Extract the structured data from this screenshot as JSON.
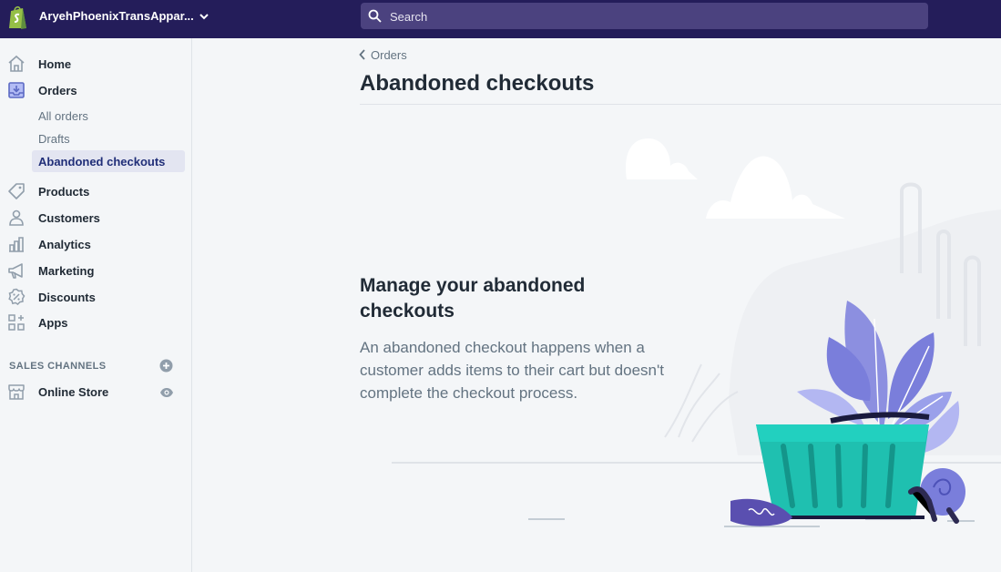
{
  "topbar": {
    "store_name": "AryehPhoenixTransAppar...",
    "search_placeholder": "Search"
  },
  "sidebar": {
    "items": [
      {
        "label": "Home",
        "icon": "home-icon"
      },
      {
        "label": "Orders",
        "icon": "orders-icon"
      },
      {
        "label": "Products",
        "icon": "tag-icon"
      },
      {
        "label": "Customers",
        "icon": "person-icon"
      },
      {
        "label": "Analytics",
        "icon": "bar-chart-icon"
      },
      {
        "label": "Marketing",
        "icon": "megaphone-icon"
      },
      {
        "label": "Discounts",
        "icon": "discount-icon"
      },
      {
        "label": "Apps",
        "icon": "apps-icon"
      }
    ],
    "order_subitems": [
      {
        "label": "All orders",
        "active": false
      },
      {
        "label": "Drafts",
        "active": false
      },
      {
        "label": "Abandoned checkouts",
        "active": true
      }
    ],
    "sales_channels_heading": "SALES CHANNELS",
    "channels": [
      {
        "label": "Online Store",
        "icon": "store-icon"
      }
    ]
  },
  "main": {
    "breadcrumb": "Orders",
    "title": "Abandoned checkouts",
    "empty_state": {
      "heading": "Manage your abandoned checkouts",
      "body": "An abandoned checkout happens when a customer adds items to their cart but doesn't complete the checkout process."
    }
  },
  "colors": {
    "topbar": "#241d5a",
    "search_bg": "#4b427f",
    "accent": "#5c6ac4",
    "active_bg": "#e3e5f1",
    "basket": "#1fc0b0"
  }
}
